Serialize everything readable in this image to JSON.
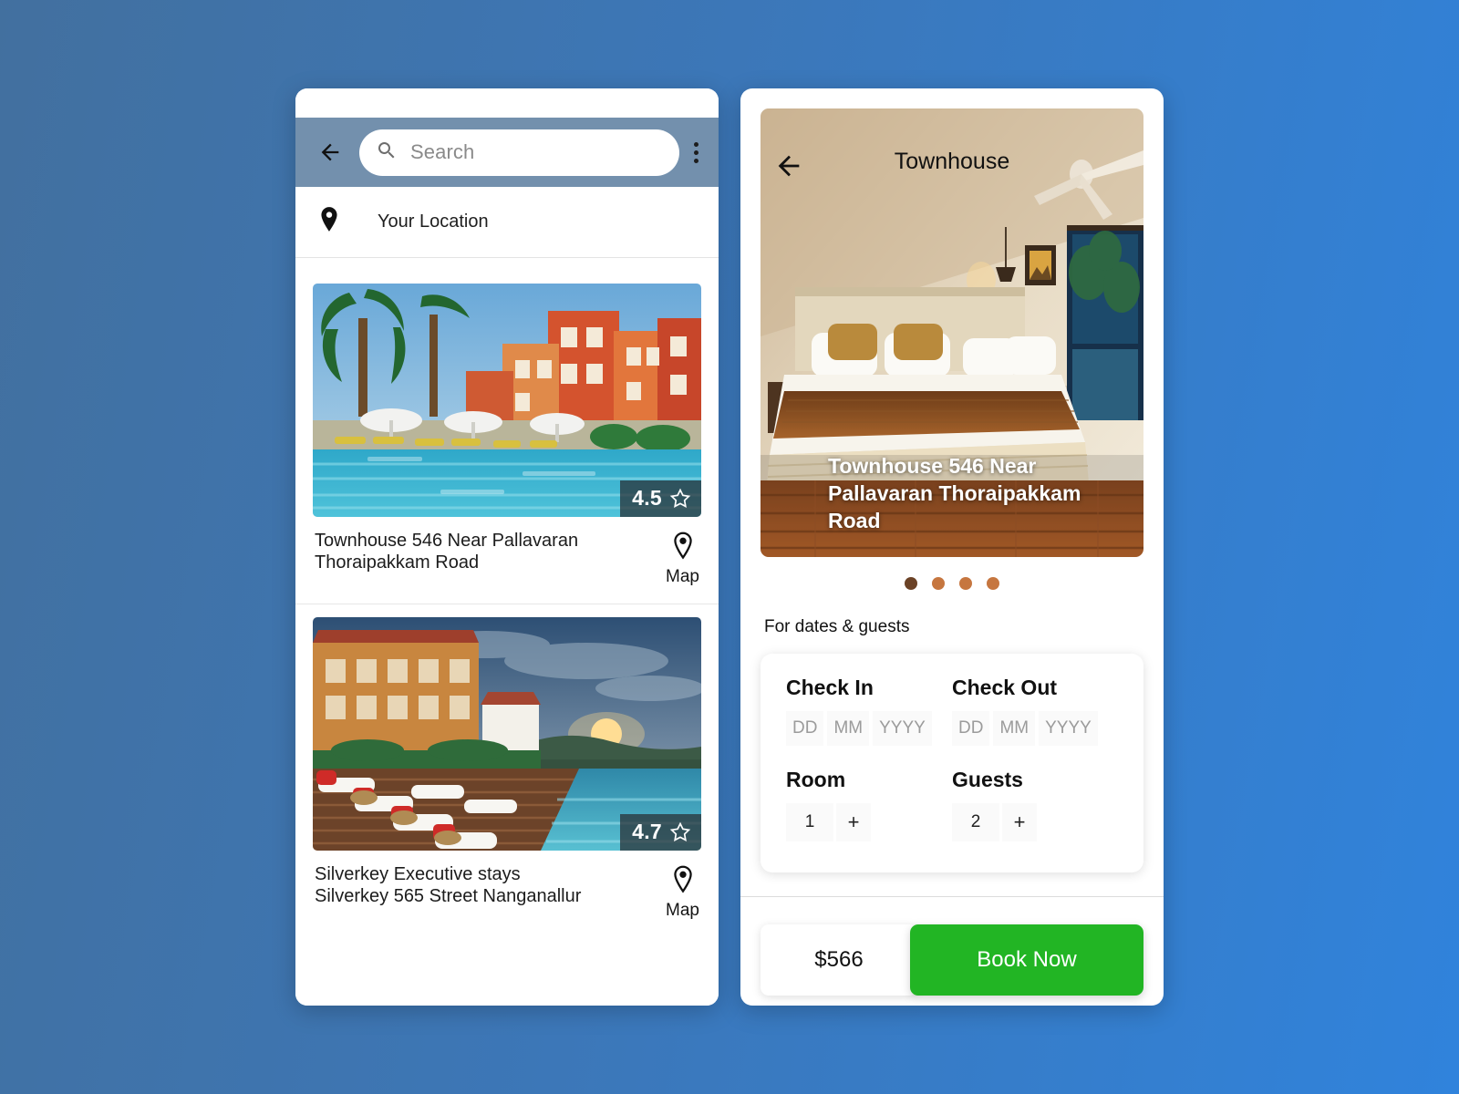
{
  "theme": {
    "bg_gradient_from": "#42709f",
    "bg_gradient_to": "#3083dc",
    "toolbar_bg": "#7390ad",
    "book_button_bg": "#22b524",
    "dot_active": "#6b4226",
    "dot_inactive": "#c6763f"
  },
  "search_screen": {
    "search": {
      "placeholder": "Search",
      "value": ""
    },
    "icons": {
      "back": "back-arrow-icon",
      "search": "search-icon",
      "overflow": "overflow-menu-icon"
    },
    "location": {
      "label": "Your Location",
      "icon": "location-pin-icon"
    },
    "listings": [
      {
        "title": "Townhouse 546 Near Pallavaran Thoraipakkam Road",
        "rating": "4.5",
        "map_label": "Map",
        "image": "resort-pool-orange-buildings"
      },
      {
        "title": "Silverkey Executive stays Silverkey 565 Street Nanganallur",
        "rating": "4.7",
        "map_label": "Map",
        "image": "infinity-pool-sunset-loungers"
      }
    ]
  },
  "detail_screen": {
    "header_title": "Townhouse",
    "back_icon": "back-arrow-icon",
    "hero_caption": "Townhouse 546 Near Pallavaran Thoraipakkam Road",
    "hero_image": "hotel-bedroom-interior",
    "carousel": {
      "total": 4,
      "active_index": 0
    },
    "form_heading": "For dates & guests",
    "check_in": {
      "label": "Check In",
      "day_placeholder": "DD",
      "month_placeholder": "MM",
      "year_placeholder": "YYYY",
      "day_value": "",
      "month_value": "",
      "year_value": ""
    },
    "check_out": {
      "label": "Check Out",
      "day_placeholder": "DD",
      "month_placeholder": "MM",
      "year_placeholder": "YYYY",
      "day_value": "",
      "month_value": "",
      "year_value": ""
    },
    "room": {
      "label": "Room",
      "value": "1",
      "increment": "+"
    },
    "guests": {
      "label": "Guests",
      "value": "2",
      "increment": "+"
    },
    "price": "$566",
    "book_label": "Book Now"
  }
}
